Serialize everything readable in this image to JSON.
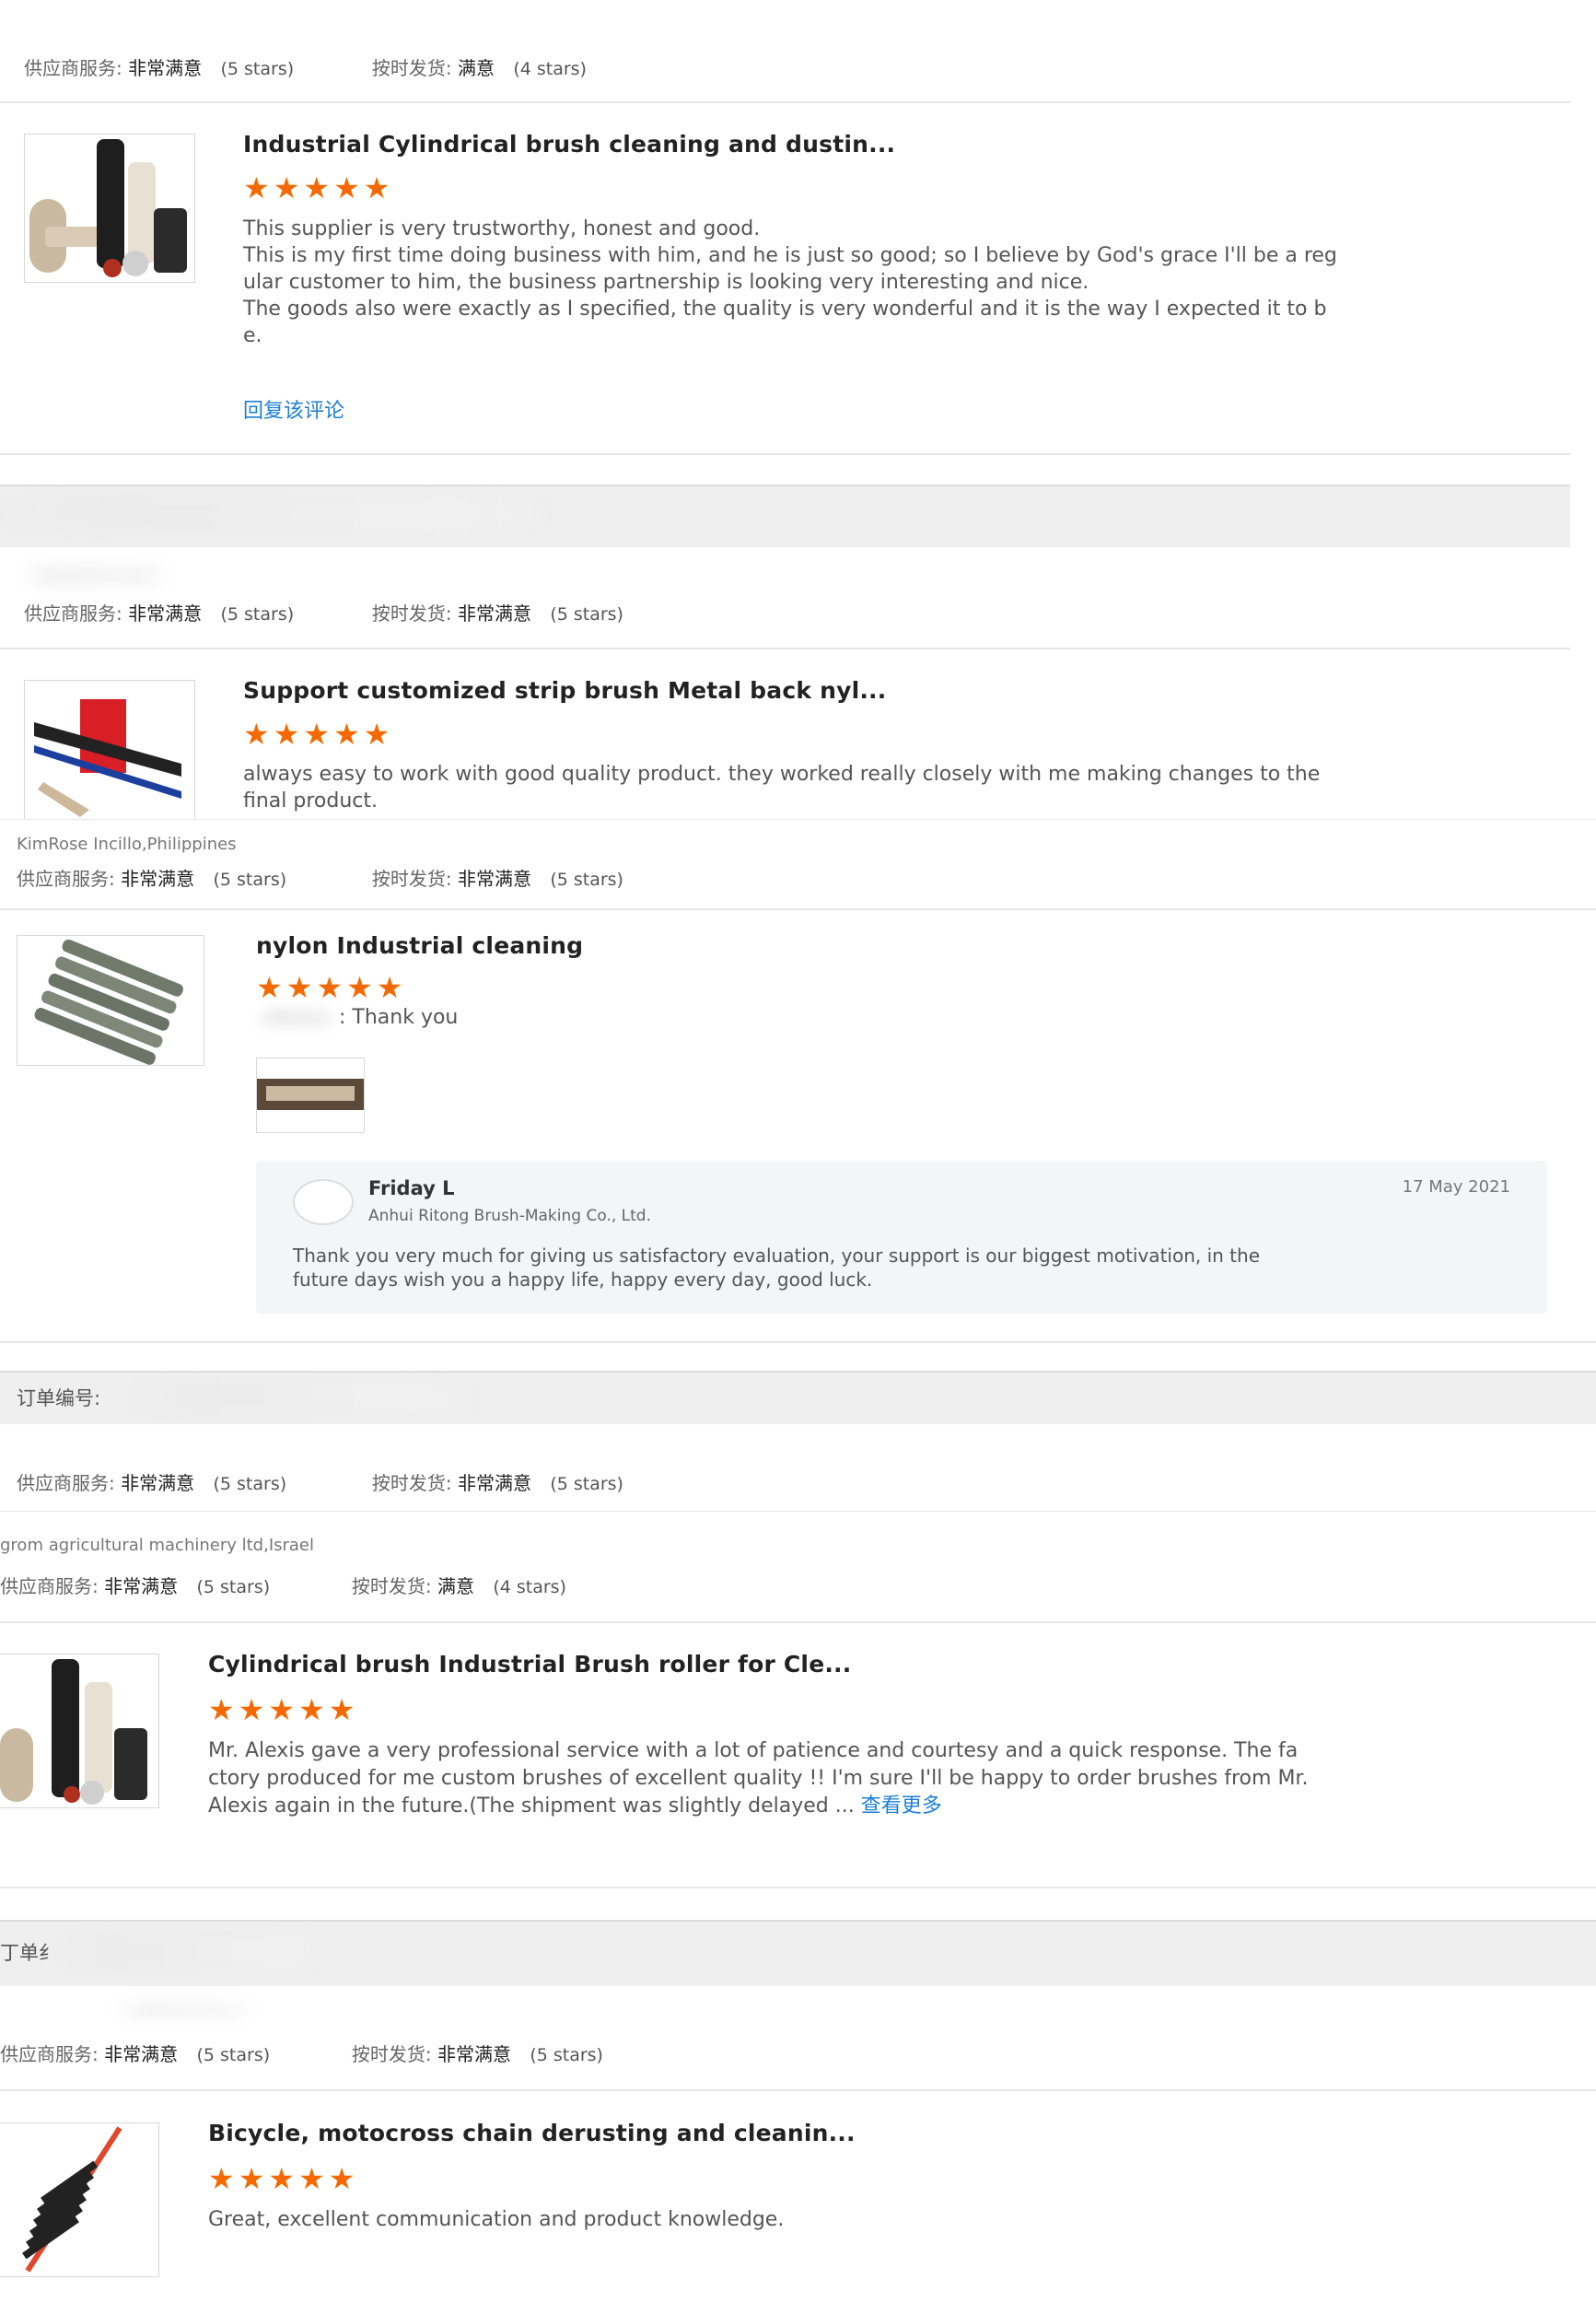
{
  "labels": {
    "supplier_service": "供应商服务:",
    "on_time_delivery": "按时发货:",
    "order_no": "订单编号:",
    "order_no_cropped": "丁单纟"
  },
  "values": {
    "very_satisfied": "非常满意",
    "satisfied": "满意",
    "five_stars": "(5 stars)",
    "four_stars": "(4 stars)"
  },
  "reviews": [
    {
      "title": "Industrial Cylindrical brush cleaning and dustin...",
      "stars": "★★★★★",
      "lines": [
        "This supplier is very trustworthy, honest and good.",
        "This is my first time doing business with him, and he is just so good; so I believe by God's grace I'll be a reg",
        "ular customer to him, the business partnership is looking very interesting and nice.",
        "The goods also were exactly as I specified, the quality is very wonderful and it is the way I expected it to b",
        "e."
      ],
      "reply_link": "回复该评论"
    },
    {
      "title": "Support customized strip brush Metal back nyl...",
      "stars": "★★★★★",
      "lines": [
        "always easy to work with   good quality product. they worked really closely with me making changes to the",
        "final product."
      ]
    },
    {
      "buyer": "KimRose Incillo,Philippines",
      "title": "nylon Industrial cleaning",
      "stars": "★★★★★",
      "text": ": Thank you",
      "reply": {
        "name": "Friday L",
        "company": "Anhui Ritong Brush-Making Co., Ltd.",
        "date": "17 May 2021",
        "lines": [
          "Thank you very much for giving us satisfactory evaluation, your support is our biggest motivation, in the",
          "future days wish you a happy life, happy every day, good luck."
        ]
      }
    },
    {
      "buyer": "grom agricultural machinery ltd,Israel",
      "title": "Cylindrical brush Industrial Brush roller for Cle...",
      "stars": "★★★★★",
      "lines": [
        "Mr. Alexis gave a very professional service with a lot of patience and courtesy and a quick response. The fa",
        "ctory produced for me custom brushes of excellent quality !! I'm sure I'll be happy to order brushes from Mr.",
        "Alexis again in the future.(The shipment was slightly delayed ..."
      ],
      "see_more": "查看更多"
    },
    {
      "title": "Bicycle, motocross chain derusting and cleanin...",
      "stars": "★★★★★",
      "text": "Great, excellent communication and product knowledge."
    }
  ],
  "colors": {
    "star": "#f56a00",
    "link": "#1e7fd6"
  }
}
